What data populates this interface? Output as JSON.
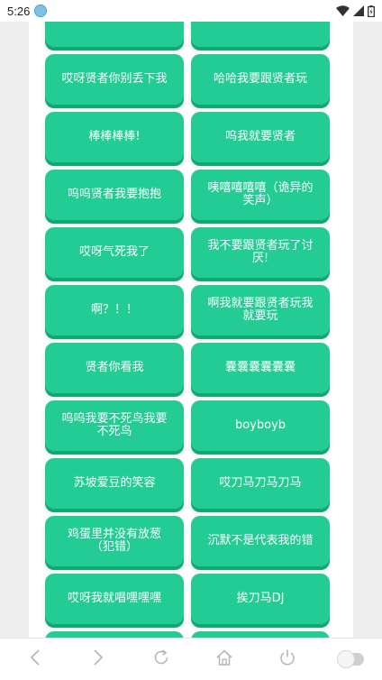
{
  "status_bar": {
    "time": "5:26",
    "icons": [
      "app-notification-icon",
      "wifi-icon",
      "signal-icon",
      "battery-icon"
    ]
  },
  "buttons": [
    {
      "label": ""
    },
    {
      "label": ""
    },
    {
      "label": "哎呀贤者你别丢下我"
    },
    {
      "label": "哈哈我要跟贤者玩"
    },
    {
      "label": "棒棒棒棒!"
    },
    {
      "label": "呜我就要贤者"
    },
    {
      "label": "呜呜贤者我要抱抱"
    },
    {
      "label": "咦嘻嘻嘻嘻（诡异的笑声）"
    },
    {
      "label": "哎呀气死我了"
    },
    {
      "label": "我不要跟贤者玩了讨厌!"
    },
    {
      "label": "啊？！！"
    },
    {
      "label": "啊我就要跟贤者玩我就要玩"
    },
    {
      "label": "贤者你看我"
    },
    {
      "label": "囊囊囊囊囊囊"
    },
    {
      "label": "呜呜我要不死鸟我要不死鸟"
    },
    {
      "label": "boyboyb"
    },
    {
      "label": "苏坡爱豆的笑容"
    },
    {
      "label": "哎刀马刀马刀马"
    },
    {
      "label": "鸡蛋里并没有放葱（犯错）"
    },
    {
      "label": "沉默不是代表我的错"
    },
    {
      "label": "哎呀我就唱嘿嘿嘿"
    },
    {
      "label": "挨刀马DJ"
    },
    {
      "label": ""
    },
    {
      "label": ""
    }
  ],
  "nav_bar": {
    "items": [
      "back-icon",
      "forward-icon",
      "refresh-icon",
      "home-icon",
      "power-icon"
    ],
    "toggle_state": "off"
  },
  "colors": {
    "button": "#22cc94",
    "button_shadow": "#15a676",
    "background": "#eeeeee",
    "panel": "#ffffff"
  }
}
